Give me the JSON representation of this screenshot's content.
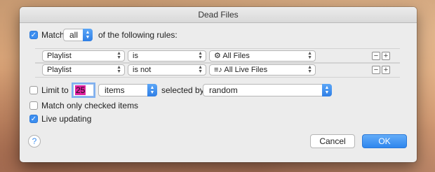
{
  "window": {
    "title": "Dead Files"
  },
  "match": {
    "label_before": "Match",
    "value": "all",
    "label_after": "of the following rules:",
    "checked": true
  },
  "rules": [
    {
      "field": "Playlist",
      "operator": "is",
      "value": "All Files",
      "value_icon": "gear-icon"
    },
    {
      "field": "Playlist",
      "operator": "is not",
      "value": "All Live Files",
      "value_icon": "playlist-icon"
    }
  ],
  "limit": {
    "label": "Limit to",
    "value": "25",
    "unit": "items",
    "selected_by_label": "selected by",
    "selected_by": "random",
    "checked": false
  },
  "match_checked": {
    "label": "Match only checked items",
    "checked": false
  },
  "live_updating": {
    "label": "Live updating",
    "checked": true
  },
  "buttons": {
    "cancel": "Cancel",
    "ok": "OK",
    "help": "?"
  },
  "colors": {
    "accent": "#3c8ef0",
    "selection": "#e020a0"
  }
}
